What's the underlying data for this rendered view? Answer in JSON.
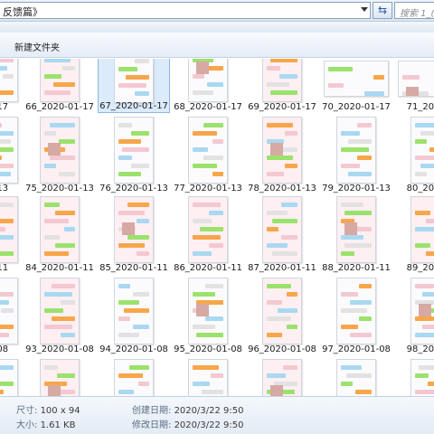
{
  "address_bar": {
    "path_fragment": "反馈篇》",
    "search_placeholder": "搜索 1_("
  },
  "toolbar": {
    "new_folder_label": "新建文件夹"
  },
  "files": [
    "...17",
    "66_2020-01-17",
    "67_2020-01-17",
    "68_2020-01-17",
    "69_2020-01-17",
    "70_2020-01-17",
    "71_2020...",
    "...13",
    "75_2020-01-13",
    "76_2020-01-13",
    "77_2020-01-13",
    "78_2020-01-13",
    "79_2020-01-13",
    "80_2020...",
    "...11",
    "84_2020-01-11",
    "85_2020-01-11",
    "86_2020-01-11",
    "87_2020-01-11",
    "88_2020-01-11",
    "89_2020...",
    "...08",
    "93_2020-01-08",
    "94_2020-01-08",
    "95_2020-01-08",
    "96_2020-01-08",
    "97_2020-01-08",
    "98_2020...",
    "",
    "",
    "",
    "",
    "",
    "",
    ""
  ],
  "selected_file_index": 2,
  "details": {
    "size_label": "尺寸:",
    "size_value": "100 x 94",
    "filesize_label": "大小:",
    "filesize_value": "1.61 KB",
    "created_label": "创建日期:",
    "created_value": "2020/3/22 9:50",
    "modified_label": "修改日期:",
    "modified_value": "2020/3/22 9:50"
  },
  "colors": {
    "selection": "#dcebfc",
    "chat_green": "#9be26d",
    "chat_orange": "#f7a64a",
    "chat_pink": "#f4c8d0"
  }
}
